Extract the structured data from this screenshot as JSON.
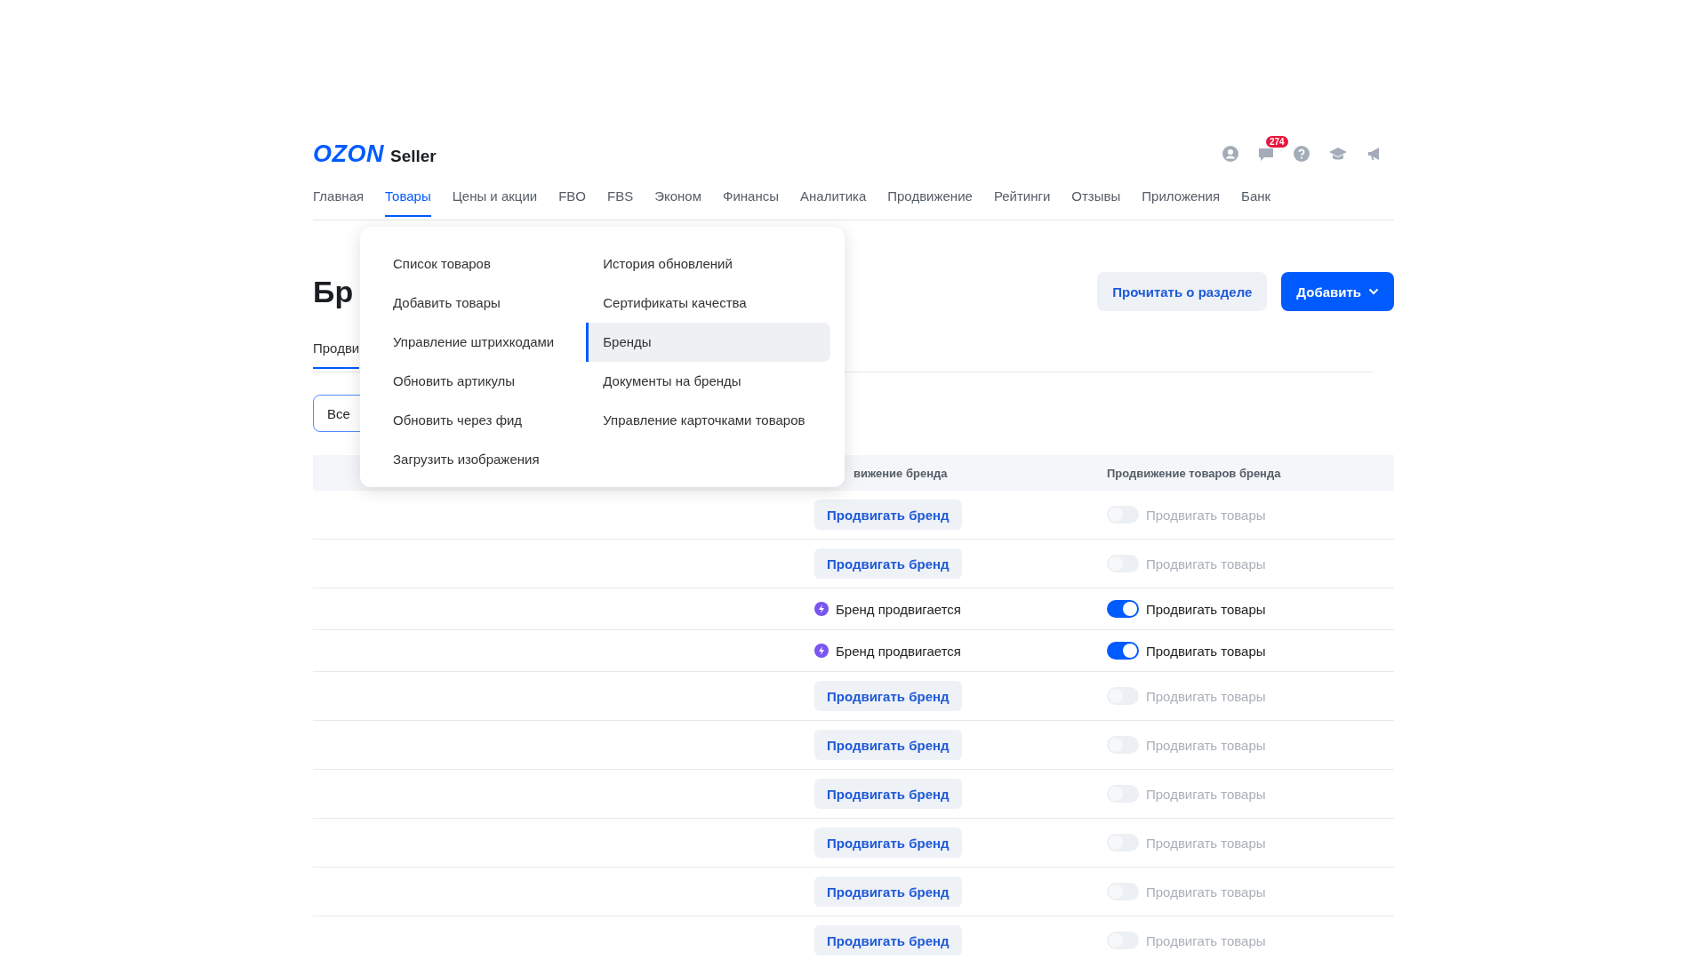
{
  "header": {
    "logo": "OZON",
    "logo_suffix": "Seller",
    "messages_badge": "274"
  },
  "nav": [
    {
      "label": "Главная",
      "selected": false
    },
    {
      "label": "Товары",
      "selected": true
    },
    {
      "label": "Цены и акции",
      "selected": false
    },
    {
      "label": "FBO",
      "selected": false
    },
    {
      "label": "FBS",
      "selected": false
    },
    {
      "label": "Эконом",
      "selected": false
    },
    {
      "label": "Финансы",
      "selected": false
    },
    {
      "label": "Аналитика",
      "selected": false
    },
    {
      "label": "Продвижение",
      "selected": false
    },
    {
      "label": "Рейтинги",
      "selected": false
    },
    {
      "label": "Отзывы",
      "selected": false
    },
    {
      "label": "Приложения",
      "selected": false
    },
    {
      "label": "Банк",
      "selected": false
    }
  ],
  "dropdown": {
    "columns": [
      [
        {
          "label": "Список товаров",
          "selected": false
        },
        {
          "label": "Добавить товары",
          "selected": false
        },
        {
          "label": "Управление штрихкодами",
          "selected": false
        },
        {
          "label": "Обновить артикулы",
          "selected": false
        },
        {
          "label": "Обновить через фид",
          "selected": false
        },
        {
          "label": "Загрузить изображения",
          "selected": false
        }
      ],
      [
        {
          "label": "История обновлений",
          "selected": false
        },
        {
          "label": "Сертификаты качества",
          "selected": false
        },
        {
          "label": "Бренды",
          "selected": true
        },
        {
          "label": "Документы на бренды",
          "selected": false
        },
        {
          "label": "Управление карточками товаров",
          "selected": false
        }
      ]
    ]
  },
  "page": {
    "title": "Бр",
    "actions": [
      {
        "label": "Прочитать о разделе",
        "kind": "secondary"
      },
      {
        "label": "Добавить",
        "kind": "primary"
      }
    ],
    "tab": {
      "label": "Продви",
      "selected": true
    },
    "filter": {
      "label": "Все",
      "selected": true
    }
  },
  "table": {
    "columns": [
      "вижение бренда",
      "Продвижение товаров бренда"
    ],
    "rows": [
      {
        "kind": "button",
        "brand": "Продвигать бренд",
        "on": false,
        "toggle_label": "Продвигать товары"
      },
      {
        "kind": "button",
        "brand": "Продвигать бренд",
        "on": false,
        "toggle_label": "Продвигать товары"
      },
      {
        "kind": "status",
        "brand": "Бренд продвигается",
        "on": true,
        "toggle_label": "Продвигать товары"
      },
      {
        "kind": "status",
        "brand": "Бренд продвигается",
        "on": true,
        "toggle_label": "Продвигать товары"
      },
      {
        "kind": "button",
        "brand": "Продвигать бренд",
        "on": false,
        "toggle_label": "Продвигать товары"
      },
      {
        "kind": "button",
        "brand": "Продвигать бренд",
        "on": false,
        "toggle_label": "Продвигать товары"
      },
      {
        "kind": "button",
        "brand": "Продвигать бренд",
        "on": false,
        "toggle_label": "Продвигать товары"
      },
      {
        "kind": "button",
        "brand": "Продвигать бренд",
        "on": false,
        "toggle_label": "Продвигать товары"
      },
      {
        "kind": "button",
        "brand": "Продвигать бренд",
        "on": false,
        "toggle_label": "Продвигать товары"
      },
      {
        "kind": "button",
        "brand": "Продвигать бренд",
        "on": false,
        "toggle_label": "Продвигать товары"
      }
    ]
  }
}
